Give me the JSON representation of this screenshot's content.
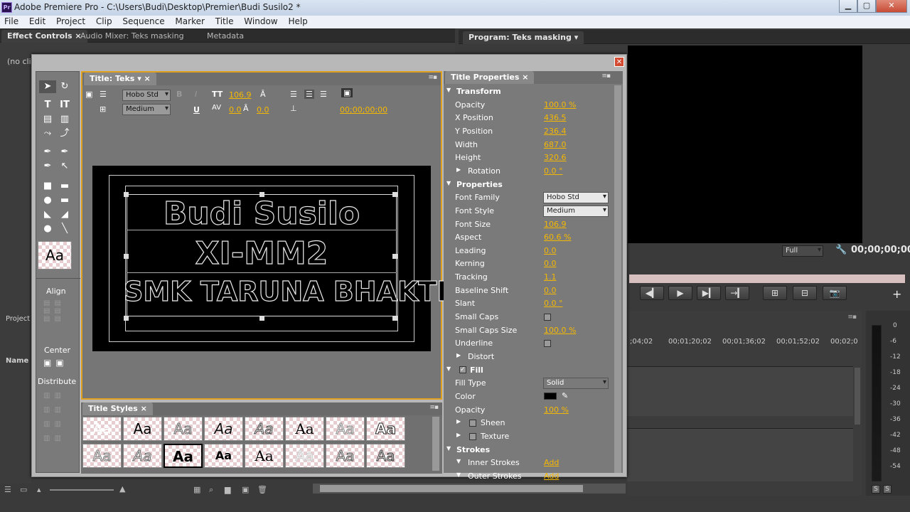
{
  "window": {
    "title": "Adobe Premiere Pro - C:\\Users\\Budi\\Desktop\\Premier\\Budi Susilo2 *",
    "app_icon": "Pr"
  },
  "menu": [
    "File",
    "Edit",
    "Project",
    "Clip",
    "Sequence",
    "Marker",
    "Title",
    "Window",
    "Help"
  ],
  "left_panel": {
    "tabs": [
      "Effect Controls",
      "Audio Mixer: Teks masking",
      "Metadata"
    ],
    "clip_label": "(no cli",
    "project_tab": "Project",
    "name_col": "Name"
  },
  "program": {
    "tab": "Program: Teks masking",
    "zoom": "Full",
    "timecode": "00;00;00;00"
  },
  "timeline": {
    "ruler": [
      ";04;02",
      "00;01;20;02",
      "00;01;36;02",
      "00;01;52;02",
      "00;02;0"
    ]
  },
  "audio_meter": {
    "labels": [
      "0",
      "-6",
      "-12",
      "-18",
      "-24",
      "-30",
      "-36",
      "-42",
      "-48",
      "-54"
    ],
    "solo": "S"
  },
  "title_panel": {
    "tab": "Title: Teks",
    "font": "Hobo Std",
    "style": "Medium",
    "size": "106.9",
    "kerning": "0.0",
    "leading": "0.0",
    "timecode": "00;00;00;00",
    "lines": [
      "Budi Susilo",
      "XI-MM2",
      "SMK TARUNA BHAKTI"
    ]
  },
  "tools": {
    "align_label": "Align",
    "center_label": "Center",
    "distribute_label": "Distribute"
  },
  "title_styles": {
    "tab": "Title Styles",
    "swatch_text": "Aa"
  },
  "properties": {
    "tab": "Title Properties",
    "rows": [
      {
        "label": "Transform",
        "value": "",
        "type": "section"
      },
      {
        "label": "Opacity",
        "value": "100.0 %"
      },
      {
        "label": "X Position",
        "value": "436.5"
      },
      {
        "label": "Y Position",
        "value": "236.4"
      },
      {
        "label": "Width",
        "value": "687.0"
      },
      {
        "label": "Height",
        "value": "320.6"
      },
      {
        "label": "Rotation",
        "value": "0.0 °",
        "type": "sub"
      },
      {
        "label": "Properties",
        "value": "",
        "type": "section"
      },
      {
        "label": "Font Family",
        "value": "Hobo Std",
        "type": "dropdown"
      },
      {
        "label": "Font Style",
        "value": "Medium",
        "type": "dropdown"
      },
      {
        "label": "Font Size",
        "value": "106.9"
      },
      {
        "label": "Aspect",
        "value": "60.6 %"
      },
      {
        "label": "Leading",
        "value": "0.0"
      },
      {
        "label": "Kerning",
        "value": "0.0"
      },
      {
        "label": "Tracking",
        "value": "1.1"
      },
      {
        "label": "Baseline Shift",
        "value": "0.0"
      },
      {
        "label": "Slant",
        "value": "0.0 °"
      },
      {
        "label": "Small Caps",
        "value": "",
        "type": "check"
      },
      {
        "label": "Small Caps Size",
        "value": "100.0 %"
      },
      {
        "label": "Underline",
        "value": "",
        "type": "check"
      },
      {
        "label": "Distort",
        "value": "",
        "type": "sub"
      },
      {
        "label": "Fill",
        "value": "",
        "type": "fill"
      },
      {
        "label": "Fill Type",
        "value": "Solid",
        "type": "dropdown"
      },
      {
        "label": "Color",
        "value": "",
        "type": "color"
      },
      {
        "label": "Opacity",
        "value": "100 %"
      },
      {
        "label": "Sheen",
        "value": "",
        "type": "subcheck"
      },
      {
        "label": "Texture",
        "value": "",
        "type": "subcheck"
      },
      {
        "label": "Strokes",
        "value": "",
        "type": "section"
      },
      {
        "label": "Inner Strokes",
        "value": "Add",
        "type": "sub"
      },
      {
        "label": "Outer Strokes",
        "value": "Add",
        "type": "sub"
      }
    ]
  },
  "colors": {
    "accent": "#f5b800",
    "selection": "#e0a020",
    "fill_color": "#000000"
  }
}
